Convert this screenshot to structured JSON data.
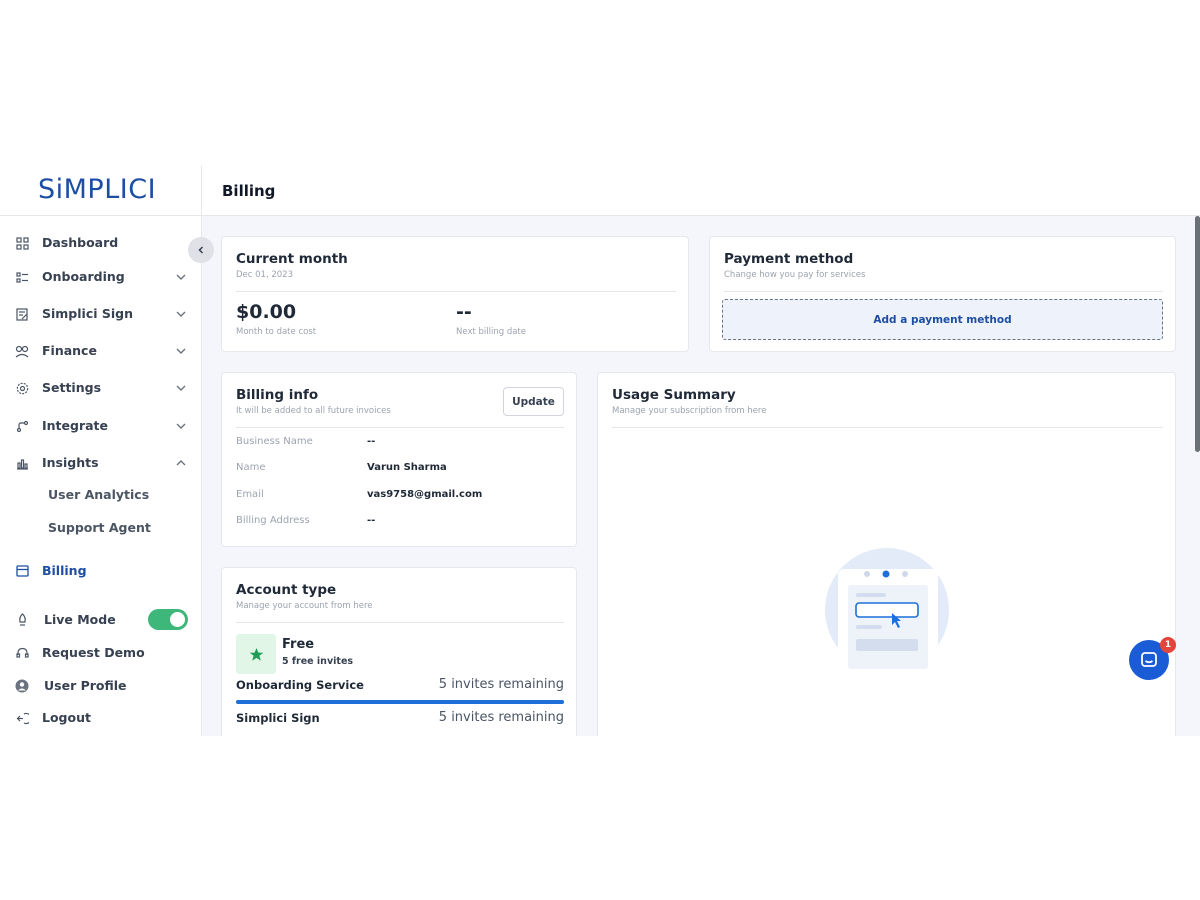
{
  "brand": {
    "logo_text": "SiMPLICI",
    "accent": "#1d4ea3"
  },
  "header": {
    "title": "Billing"
  },
  "sidebar": {
    "items": [
      {
        "label": "Dashboard",
        "icon": "grid-icon"
      },
      {
        "label": "Onboarding",
        "icon": "list-icon",
        "chevron": "down"
      },
      {
        "label": "Simplici Sign",
        "icon": "edit-icon",
        "chevron": "down"
      },
      {
        "label": "Finance",
        "icon": "coins-icon",
        "chevron": "down"
      },
      {
        "label": "Settings",
        "icon": "gear-icon",
        "chevron": "down"
      },
      {
        "label": "Integrate",
        "icon": "integrate-icon",
        "chevron": "down"
      },
      {
        "label": "Insights",
        "icon": "bar-chart-icon",
        "chevron": "up"
      }
    ],
    "insights_sub": [
      "User Analytics",
      "Support Agent"
    ],
    "billing": "Billing",
    "live_mode": {
      "label": "Live Mode",
      "on": true
    },
    "bottom": [
      {
        "label": "Request Demo",
        "icon": "headset-icon"
      },
      {
        "label": "User Profile",
        "icon": "user-icon"
      },
      {
        "label": "Logout",
        "icon": "logout-icon"
      }
    ]
  },
  "current_month": {
    "title": "Current month",
    "date": "Dec 01, 2023",
    "cost_value": "$0.00",
    "cost_label": "Month to date cost",
    "next_value": "--",
    "next_label": "Next billing date"
  },
  "payment_method": {
    "title": "Payment method",
    "subtitle": "Change how you pay for services",
    "button": "Add a payment method"
  },
  "billing_info": {
    "title": "Billing info",
    "subtitle": "It will be added to all future invoices",
    "update": "Update",
    "rows": [
      {
        "key": "Business Name",
        "value": "--"
      },
      {
        "key": "Name",
        "value": "Varun Sharma"
      },
      {
        "key": "Email",
        "value": "vas9758@gmail.com"
      },
      {
        "key": "Billing Address",
        "value": "--"
      }
    ]
  },
  "account_type": {
    "title": "Account type",
    "subtitle": "Manage your account from here",
    "plan": "Free",
    "plan_invites": "5 free invites",
    "services": [
      {
        "name": "Onboarding Service",
        "remaining": "5 invites remaining"
      },
      {
        "name": "Simplici Sign",
        "remaining": "5 invites remaining"
      }
    ]
  },
  "usage_summary": {
    "title": "Usage Summary",
    "subtitle": "Manage your subscription from here"
  },
  "chat": {
    "badge": "1"
  }
}
